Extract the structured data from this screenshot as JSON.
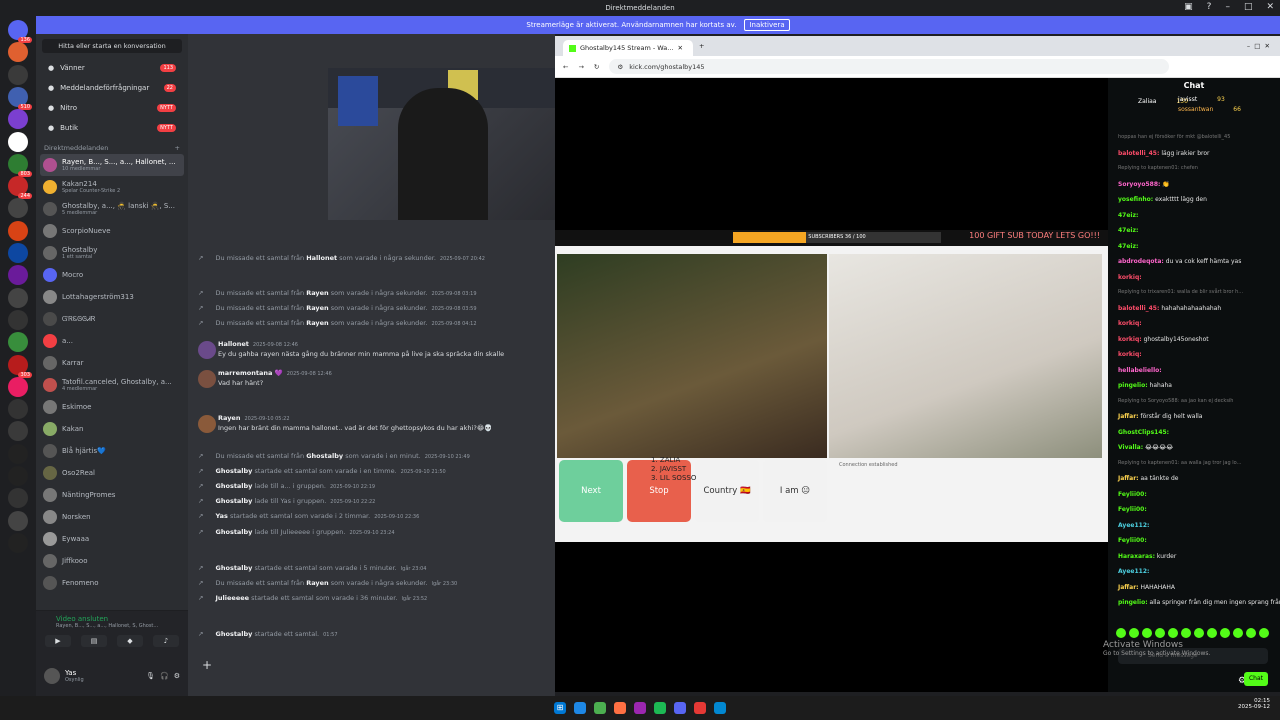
{
  "window": {
    "title": "Direktmeddelanden"
  },
  "banner": {
    "text": "Streamerläge är aktiverat. Användarnamnen har kortats av.",
    "button": "Inaktivera"
  },
  "servers": [
    {
      "badge": "136",
      "color": "#5865f2"
    },
    {
      "badge": "",
      "color": "#e06030"
    },
    {
      "badge": "",
      "color": "#3a3a3a"
    },
    {
      "badge": "510",
      "color": "#4060b0"
    },
    {
      "badge": "",
      "color": "#7b3fd0"
    },
    {
      "badge": "",
      "color": "#ffffff"
    },
    {
      "badge": "803",
      "color": "#2e7d32"
    },
    {
      "badge": "244",
      "color": "#c62828"
    },
    {
      "badge": "",
      "color": "#444"
    },
    {
      "badge": "",
      "color": "#d84315"
    },
    {
      "badge": "",
      "color": "#0d47a1"
    },
    {
      "badge": "",
      "color": "#6a1b9a"
    },
    {
      "badge": "",
      "color": "#444"
    },
    {
      "badge": "",
      "color": "#333"
    },
    {
      "badge": "",
      "color": "#388e3c"
    },
    {
      "badge": "303",
      "color": "#b71c1c"
    },
    {
      "badge": "",
      "color": "#e91e63"
    },
    {
      "badge": "",
      "color": "#333"
    },
    {
      "badge": "",
      "color": "#3a3a3a"
    },
    {
      "badge": "",
      "color": "#222"
    },
    {
      "badge": "",
      "color": "#222"
    },
    {
      "badge": "",
      "color": "#333"
    },
    {
      "badge": "",
      "color": "#444"
    },
    {
      "badge": "",
      "color": "#222"
    }
  ],
  "dm": {
    "search": "Hitta eller starta en konversation",
    "nav": [
      {
        "label": "Vänner",
        "pill": "113"
      },
      {
        "label": "Meddelandeförfrågningar",
        "pill": "22"
      },
      {
        "label": "Nitro",
        "pill": "NYTT"
      },
      {
        "label": "Butik",
        "pill": "NYTT"
      }
    ],
    "header": "Direktmeddelanden",
    "items": [
      {
        "name": "Rayen, B..., S..., a..., Hallonet, ...",
        "sub": "10 medlemmar",
        "color": "#b05090"
      },
      {
        "name": "Kakan214",
        "sub": "Spelar Counter-Strike 2",
        "color": "#f0b030"
      },
      {
        "name": "Ghostalby, a..., 🥷 lanski 🥷, S...",
        "sub": "5 medlemmar",
        "color": "#555"
      },
      {
        "name": "ScorpioNueve",
        "sub": "",
        "color": "#777"
      },
      {
        "name": "Ghostalby",
        "sub": "1 ett samtal",
        "color": "#666"
      },
      {
        "name": "Mocro",
        "sub": "",
        "color": "#5865f2"
      },
      {
        "name": "Lottahagerström313",
        "sub": "",
        "color": "#888"
      },
      {
        "name": "ᏳᏒᏋᎶᎶᏗᏒ",
        "sub": "",
        "color": "#4a4a4a"
      },
      {
        "name": "a...",
        "sub": "",
        "color": "#f23f43"
      },
      {
        "name": "Karrar",
        "sub": "",
        "color": "#666"
      },
      {
        "name": "Tatofil.canceled, Ghostalby, a...",
        "sub": "4 medlemmar",
        "color": "#c0504d"
      },
      {
        "name": "Eskimoe",
        "sub": "",
        "color": "#777"
      },
      {
        "name": "Kakan",
        "sub": "",
        "color": "#8a6"
      },
      {
        "name": "Blå hjärtis💙",
        "sub": "",
        "color": "#555"
      },
      {
        "name": "Oso2Real",
        "sub": "",
        "color": "#664"
      },
      {
        "name": "NäntingPromes",
        "sub": "",
        "color": "#777"
      },
      {
        "name": "Norsken",
        "sub": "",
        "color": "#888"
      },
      {
        "name": "Eywaaa",
        "sub": "",
        "color": "#999"
      },
      {
        "name": "Jiffkooo",
        "sub": "",
        "color": "#666"
      },
      {
        "name": "Fenomeno",
        "sub": "",
        "color": "#555"
      }
    ],
    "voice": {
      "status": "Video ansluten",
      "channel": "Rayen, B..., S..., a..., Hallonet, S, Ghost..."
    },
    "user": {
      "name": "Yas",
      "status": "Osynlig"
    }
  },
  "chat": {
    "messages": [
      {
        "type": "sys",
        "text": "Du missade ett samtal från ",
        "bold": "Hallonet",
        "rest": " som varade i några sekunder.",
        "ts": "2025-09-07 20:42"
      },
      {
        "type": "sys",
        "text": "Du missade ett samtal från ",
        "bold": "Rayen",
        "rest": " som varade i några sekunder.",
        "ts": "2025-09-08 03:19"
      },
      {
        "type": "sys",
        "text": "Du missade ett samtal från ",
        "bold": "Rayen",
        "rest": " som varade i några sekunder.",
        "ts": "2025-09-08 03:59"
      },
      {
        "type": "sys",
        "text": "Du missade ett samtal från ",
        "bold": "Rayen",
        "rest": " som varade i några sekunder.",
        "ts": "2025-09-08 04:12"
      },
      {
        "type": "author",
        "name": "Hallonet",
        "ts": "2025-09-08 12:46",
        "text": "Ey du gahba rayen nästa gång du bränner min mamma på live ja ska spräcka din skalle"
      },
      {
        "type": "author",
        "name": "marremontana 💜",
        "ts": "2025-09-08 12:46",
        "text": "Vad har hänt?"
      },
      {
        "type": "author",
        "name": "Rayen",
        "ts": "2025-09-10 05:22",
        "text": "Ingen har bränt din mamma hallonet.. vad är det för ghettopsykos du har akhi?😂💀"
      },
      {
        "type": "sys",
        "text": "Du missade ett samtal från ",
        "bold": "Ghostalby",
        "rest": " som varade i en minut.",
        "ts": "2025-09-10 21:49"
      },
      {
        "type": "sys",
        "text": "",
        "bold": "Ghostalby",
        "rest": " startade ett samtal som varade i en timme.",
        "ts": "2025-09-10 21:50"
      },
      {
        "type": "sys",
        "text": "",
        "bold": "Ghostalby",
        "rest": " lade till a... i gruppen.",
        "ts": "2025-09-10 22:19"
      },
      {
        "type": "sys",
        "text": "",
        "bold": "Ghostalby",
        "rest": " lade till Yas i gruppen.",
        "ts": "2025-09-10 22:22"
      },
      {
        "type": "sys",
        "text": "",
        "bold": "Yas",
        "rest": " startade ett samtal som varade i 2 timmar.",
        "ts": "2025-09-10 22:36"
      },
      {
        "type": "sys",
        "text": "",
        "bold": "Ghostalby",
        "rest": " lade till Julieeeee i gruppen.",
        "ts": "2025-09-10 23:24"
      },
      {
        "type": "sys",
        "text": "",
        "bold": "Ghostalby",
        "rest": " startade ett samtal som varade i 5 minuter.",
        "ts": "Igår 23:04"
      },
      {
        "type": "sys",
        "text": "Du missade ett samtal från ",
        "bold": "Rayen",
        "rest": " som varade i några sekunder.",
        "ts": "Igår 23:30"
      },
      {
        "type": "sys",
        "text": "",
        "bold": "Julieeeee",
        "rest": " startade ett samtal som varade i 36 minuter.",
        "ts": "Igår 23:52"
      },
      {
        "type": "sys",
        "text": "",
        "bold": "Ghostalby",
        "rest": " startade ett samtal.",
        "ts": "01:57"
      }
    ]
  },
  "browser": {
    "tab": "Ghostalby145 Stream - Wa...",
    "url": "kick.com/ghostalby145",
    "stream": {
      "subscribers": "SUBSCRIBERS",
      "sub_count": "36 / 100",
      "sub_progress": 0.35,
      "promo": "100 GIFT SUB TODAY LETS GO!!!",
      "names": [
        "1. ZALIA",
        "2. JAVISST",
        "3. LIL SOSSO"
      ],
      "btn_next": "Next",
      "btn_stop": "Stop",
      "btn_country": "Country 🇪🇸",
      "btn_iam": "I am 😐",
      "conn": "Connection established"
    },
    "chat": {
      "title": "Chat",
      "leaders": [
        {
          "name": "Zaliaa",
          "count": "130"
        },
        {
          "name": "javisst",
          "count": "93"
        },
        {
          "name": "sossantwan",
          "count": "66"
        }
      ],
      "messages": [
        {
          "u": "",
          "c": "rep",
          "t": "hoppas han ej försöker för mkt @balotelli_45"
        },
        {
          "u": "balotelli_45:",
          "c": "red",
          "t": "lägg irakier bror"
        },
        {
          "u": "",
          "c": "rep",
          "t": "Replying to kaptenen01: chefen"
        },
        {
          "u": "Soryoyo588:",
          "c": "pink",
          "t": "👏"
        },
        {
          "u": "yosefinho:",
          "c": "",
          "t": "exaktttt lägg den"
        },
        {
          "u": "47eiz:",
          "c": "",
          "t": ""
        },
        {
          "u": "47eiz:",
          "c": "",
          "t": ""
        },
        {
          "u": "47eiz:",
          "c": "",
          "t": ""
        },
        {
          "u": "abdrodeqota:",
          "c": "pink",
          "t": "du va cok keff hämta yas"
        },
        {
          "u": "korkiq:",
          "c": "red",
          "t": ""
        },
        {
          "u": "",
          "c": "rep",
          "t": "Replying to trixaren01: walla de blir svårt bror h..."
        },
        {
          "u": "balotelli_45:",
          "c": "red",
          "t": "hahahahahaahahah"
        },
        {
          "u": "korkiq:",
          "c": "red",
          "t": ""
        },
        {
          "u": "korkiq:",
          "c": "red",
          "t": "ghostalby145oneshot"
        },
        {
          "u": "korkiq:",
          "c": "red",
          "t": ""
        },
        {
          "u": "hellabeliello:",
          "c": "pink",
          "t": ""
        },
        {
          "u": "pingelio:",
          "c": "",
          "t": "hahaha"
        },
        {
          "u": "",
          "c": "rep",
          "t": "Replying to Soryoyo588: aa jao kan ej decksih"
        },
        {
          "u": "Jaffar:",
          "c": "yellow",
          "t": "förstår dig helt walla"
        },
        {
          "u": "GhostClips145:",
          "c": "",
          "t": ""
        },
        {
          "u": "Vivalla:",
          "c": "",
          "t": "😂😂😂😂"
        },
        {
          "u": "",
          "c": "rep",
          "t": "Replying to kaptenen01: aa walla jag tror jag lo..."
        },
        {
          "u": "Jaffar:",
          "c": "yellow",
          "t": "aa tänkte de"
        },
        {
          "u": "Feylii00:",
          "c": "",
          "t": ""
        },
        {
          "u": "Feylii00:",
          "c": "",
          "t": ""
        },
        {
          "u": "Ayee112:",
          "c": "cyan",
          "t": ""
        },
        {
          "u": "Feylii00:",
          "c": "",
          "t": ""
        },
        {
          "u": "Haraxaras:",
          "c": "",
          "t": "kurder"
        },
        {
          "u": "Ayee112:",
          "c": "cyan",
          "t": ""
        },
        {
          "u": "Jaffar:",
          "c": "yellow",
          "t": "HAHAHAHA"
        },
        {
          "u": "pingelio:",
          "c": "",
          "t": "alla springer från dig men ingen sprang från yas😂"
        }
      ],
      "input_placeholder": "Send a message",
      "send": "Chat"
    }
  },
  "watermark": {
    "title": "Activate Windows",
    "sub": "Go to Settings to activate Windows."
  },
  "clock": {
    "time": "02:15",
    "date": "2025-09-12"
  }
}
